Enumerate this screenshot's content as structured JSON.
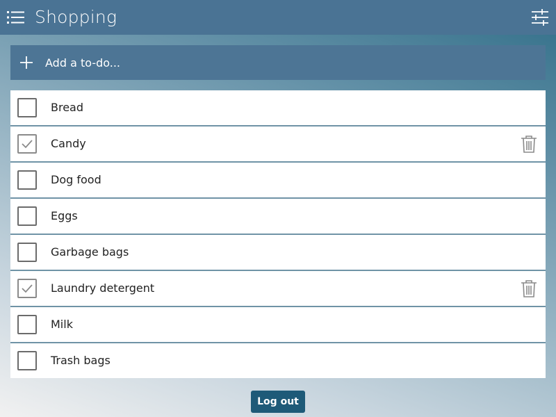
{
  "header": {
    "title": "Shopping",
    "menu_icon": "list-menu-icon",
    "settings_icon": "sliders-settings-icon"
  },
  "add_bar": {
    "placeholder": "Add a to-do...",
    "icon": "plus-icon"
  },
  "items": [
    {
      "label": "Bread",
      "checked": false
    },
    {
      "label": "Candy",
      "checked": true
    },
    {
      "label": "Dog food",
      "checked": false
    },
    {
      "label": "Eggs",
      "checked": false
    },
    {
      "label": "Garbage bags",
      "checked": false
    },
    {
      "label": "Laundry detergent",
      "checked": true
    },
    {
      "label": "Milk",
      "checked": false
    },
    {
      "label": "Trash bags",
      "checked": false
    }
  ],
  "logout": {
    "label": "Log out"
  },
  "colors": {
    "header_bg": "#4a7394",
    "add_bar_bg": "#4d7595",
    "logout_bg": "#1e5a78",
    "divider": "#6f93a6"
  }
}
